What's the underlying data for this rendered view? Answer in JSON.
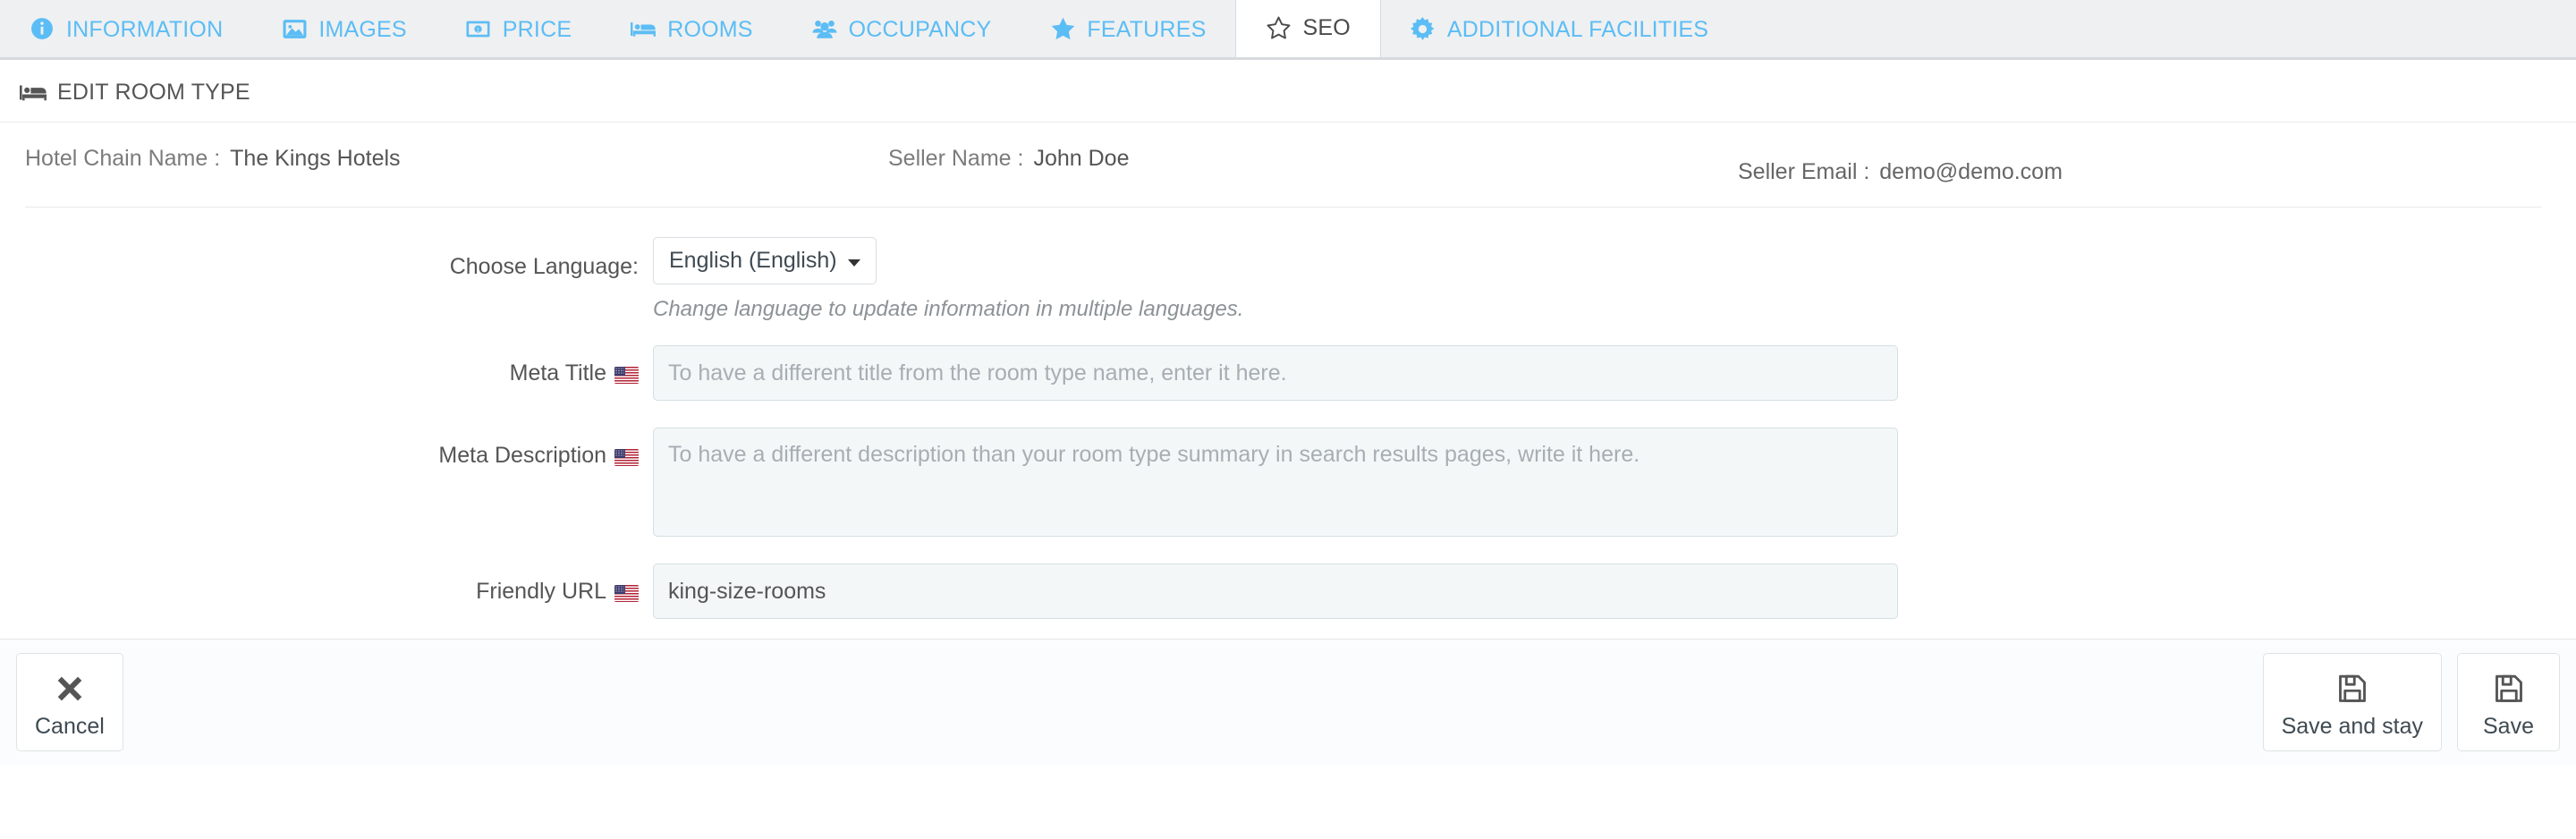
{
  "tabs": [
    {
      "id": "information",
      "label": "INFORMATION",
      "icon": "info-circle-icon",
      "active": false
    },
    {
      "id": "images",
      "label": "IMAGES",
      "icon": "image-icon",
      "active": false
    },
    {
      "id": "price",
      "label": "PRICE",
      "icon": "money-bill-icon",
      "active": false
    },
    {
      "id": "rooms",
      "label": "ROOMS",
      "icon": "bed-icon",
      "active": false
    },
    {
      "id": "occupancy",
      "label": "OCCUPANCY",
      "icon": "users-icon",
      "active": false
    },
    {
      "id": "features",
      "label": "FEATURES",
      "icon": "star-filled-icon",
      "active": false
    },
    {
      "id": "seo",
      "label": "SEO",
      "icon": "star-outline-icon",
      "active": true
    },
    {
      "id": "additional-facilities",
      "label": "ADDITIONAL FACILITIES",
      "icon": "gear-icon",
      "active": false
    }
  ],
  "panel": {
    "header_title": "EDIT ROOM TYPE",
    "header_icon": "bed-icon"
  },
  "info": {
    "chain_label": "Hotel Chain Name :",
    "chain_value": "The Kings Hotels",
    "seller_label": "Seller Name :",
    "seller_value": "John Doe",
    "email_label": "Seller Email :",
    "email_value": "demo@demo.com"
  },
  "form": {
    "language": {
      "label": "Choose Language:",
      "selected": "English (English)",
      "hint": "Change language to update information in multiple languages.",
      "options": [
        "English (English)"
      ]
    },
    "meta_title": {
      "label": "Meta Title",
      "flag": "us-flag-icon",
      "value": "",
      "placeholder": "To have a different title from the room type name, enter it here."
    },
    "meta_description": {
      "label": "Meta Description",
      "flag": "us-flag-icon",
      "value": "",
      "placeholder": "To have a different description than your room type summary in search results pages, write it here."
    },
    "friendly_url": {
      "label": "Friendly URL",
      "flag": "us-flag-icon",
      "value": "king-size-rooms",
      "placeholder": ""
    }
  },
  "footer": {
    "cancel": {
      "label": "Cancel",
      "icon": "times-icon"
    },
    "save_and_stay": {
      "label": "Save and stay",
      "icon": "floppy-disk-icon"
    },
    "save": {
      "label": "Save",
      "icon": "floppy-disk-icon"
    }
  },
  "colors": {
    "tab_accent": "#5bbdf5",
    "tabbar_bg": "#eff0f1",
    "panel_bg": "#ffffff",
    "input_bg": "#f4f7f8",
    "input_border": "#d4dfe3",
    "text": "#555555",
    "muted": "#8c9296",
    "footer_bg": "#fbfcfd"
  }
}
